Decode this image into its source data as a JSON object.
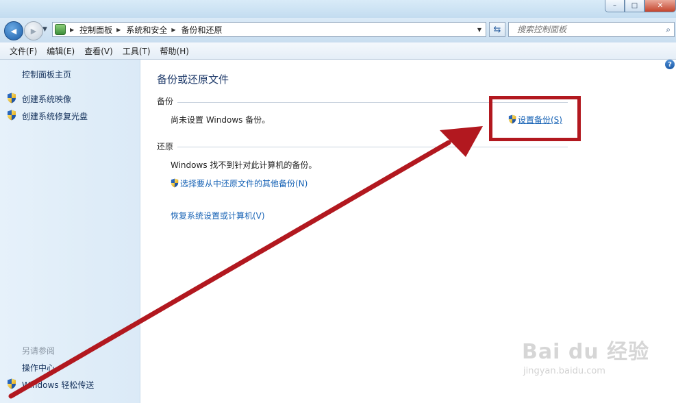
{
  "window": {
    "minimize": "–",
    "maximize": "□",
    "close": "✕"
  },
  "nav": {
    "back_glyph": "◀",
    "forward_glyph": "▶",
    "breadcrumbs": [
      "控制面板",
      "系统和安全",
      "备份和还原"
    ],
    "search_placeholder": "搜索控制面板"
  },
  "menu": [
    "文件(F)",
    "编辑(E)",
    "查看(V)",
    "工具(T)",
    "帮助(H)"
  ],
  "sidebar": {
    "home": "控制面板主页",
    "links": [
      "创建系统映像",
      "创建系统修复光盘"
    ],
    "see_also_title": "另请参阅",
    "see_also": [
      "操作中心",
      "Windows 轻松传送"
    ]
  },
  "main": {
    "title": "备份或还原文件",
    "backup_header": "备份",
    "backup_status": "尚未设置 Windows 备份。",
    "setup_backup_link": "设置备份(S)",
    "restore_header": "还原",
    "restore_status": "Windows 找不到针对此计算机的备份。",
    "other_backup_link": "选择要从中还原文件的其他备份(N)",
    "recover_link": "恢复系统设置或计算机(V)"
  },
  "annotation": {
    "color": "#b2181f"
  },
  "watermark": {
    "brand": "Bai du 经验",
    "url": "jingyan.baidu.com"
  },
  "colors": {
    "link": "#1662b5",
    "sidebar_link": "#15325c",
    "title": "#1e3a6a"
  },
  "icons": [
    "back-icon",
    "forward-icon",
    "control-panel-icon",
    "refresh-icon",
    "search-icon",
    "uac-shield-icon",
    "help-icon"
  ]
}
